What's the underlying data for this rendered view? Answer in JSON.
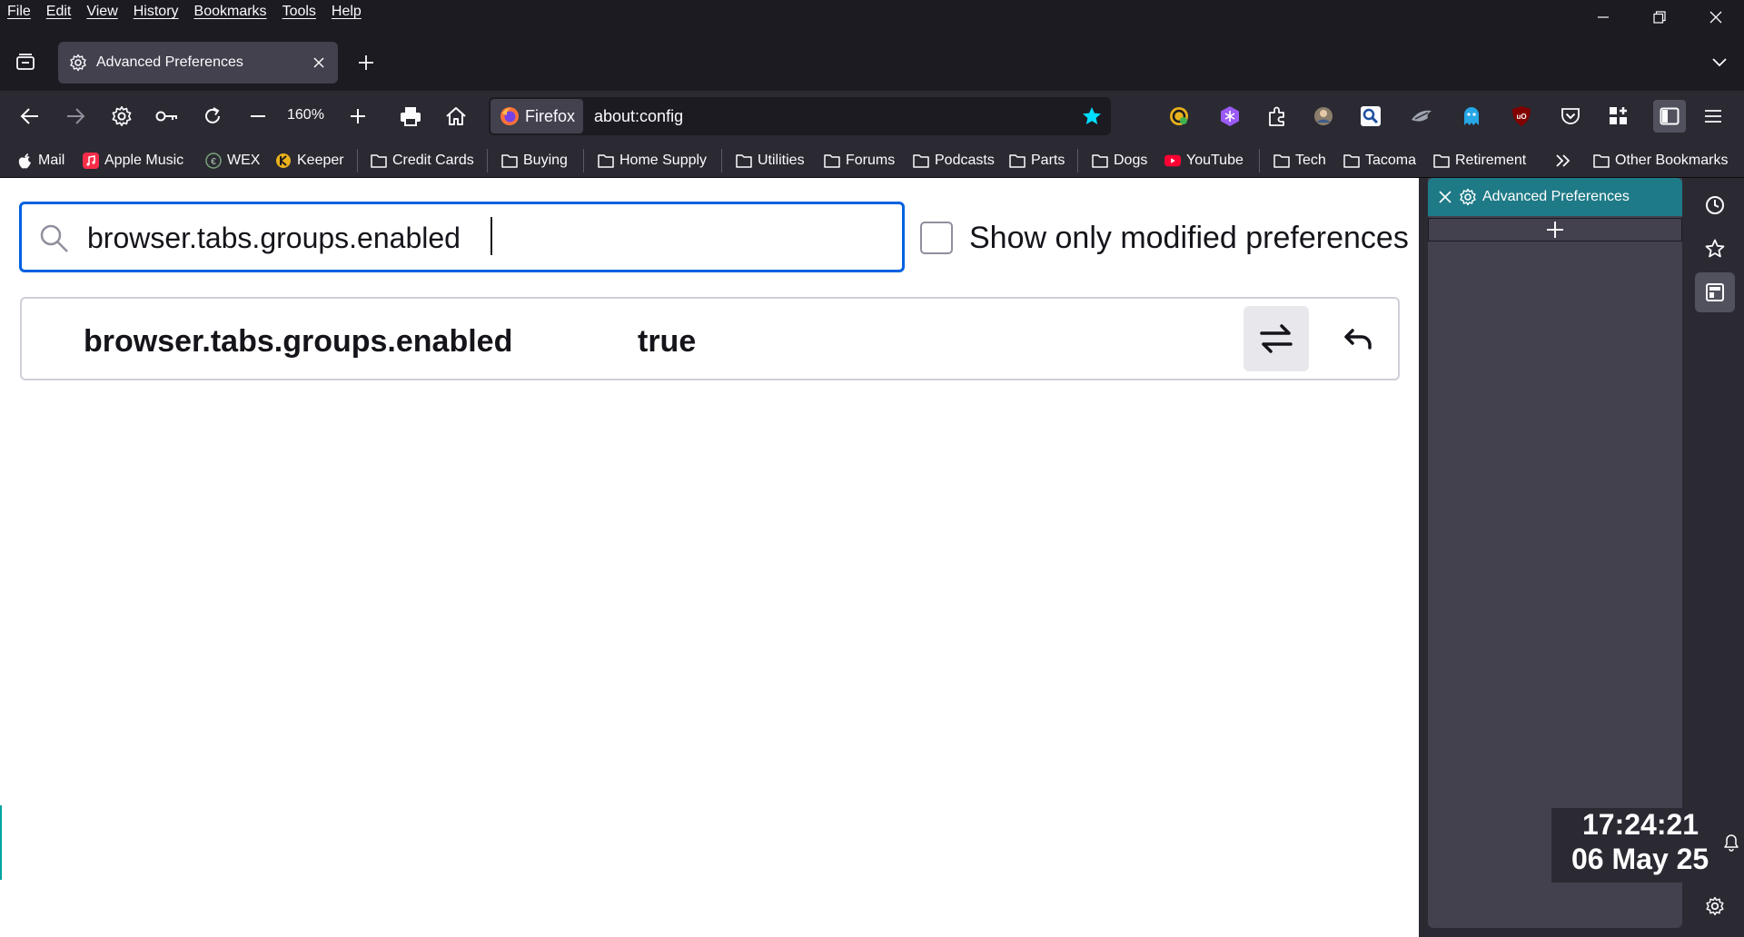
{
  "menu": [
    "File",
    "Edit",
    "View",
    "History",
    "Bookmarks",
    "Tools",
    "Help"
  ],
  "tab": {
    "title": "Advanced Preferences"
  },
  "navbar": {
    "zoom": "160%",
    "identity_label": "Firefox",
    "url": "about:config"
  },
  "bookmarks": {
    "items": [
      "Mail",
      "Apple Music",
      "WEX",
      "Keeper",
      "Credit Cards",
      "Buying",
      "Home Supply",
      "Utilities",
      "Forums",
      "Podcasts",
      "Parts",
      "Dogs",
      "YouTube",
      "Tech",
      "Tacoma",
      "Retirement"
    ],
    "other": "Other Bookmarks"
  },
  "config": {
    "search_value": "browser.tabs.groups.enabled",
    "show_modified_label": "Show only modified preferences",
    "rows": [
      {
        "name": "browser.tabs.groups.enabled",
        "value": "true"
      }
    ]
  },
  "sidebar": {
    "tab_title": "Advanced Preferences"
  },
  "clock": {
    "time": "17:24:21",
    "date": "06 May 25"
  },
  "colors": {
    "accent": "#0061e0",
    "sidebar_tab": "#1f7a87",
    "chrome_dark": "#1c1b22",
    "chrome": "#2b2a33"
  }
}
